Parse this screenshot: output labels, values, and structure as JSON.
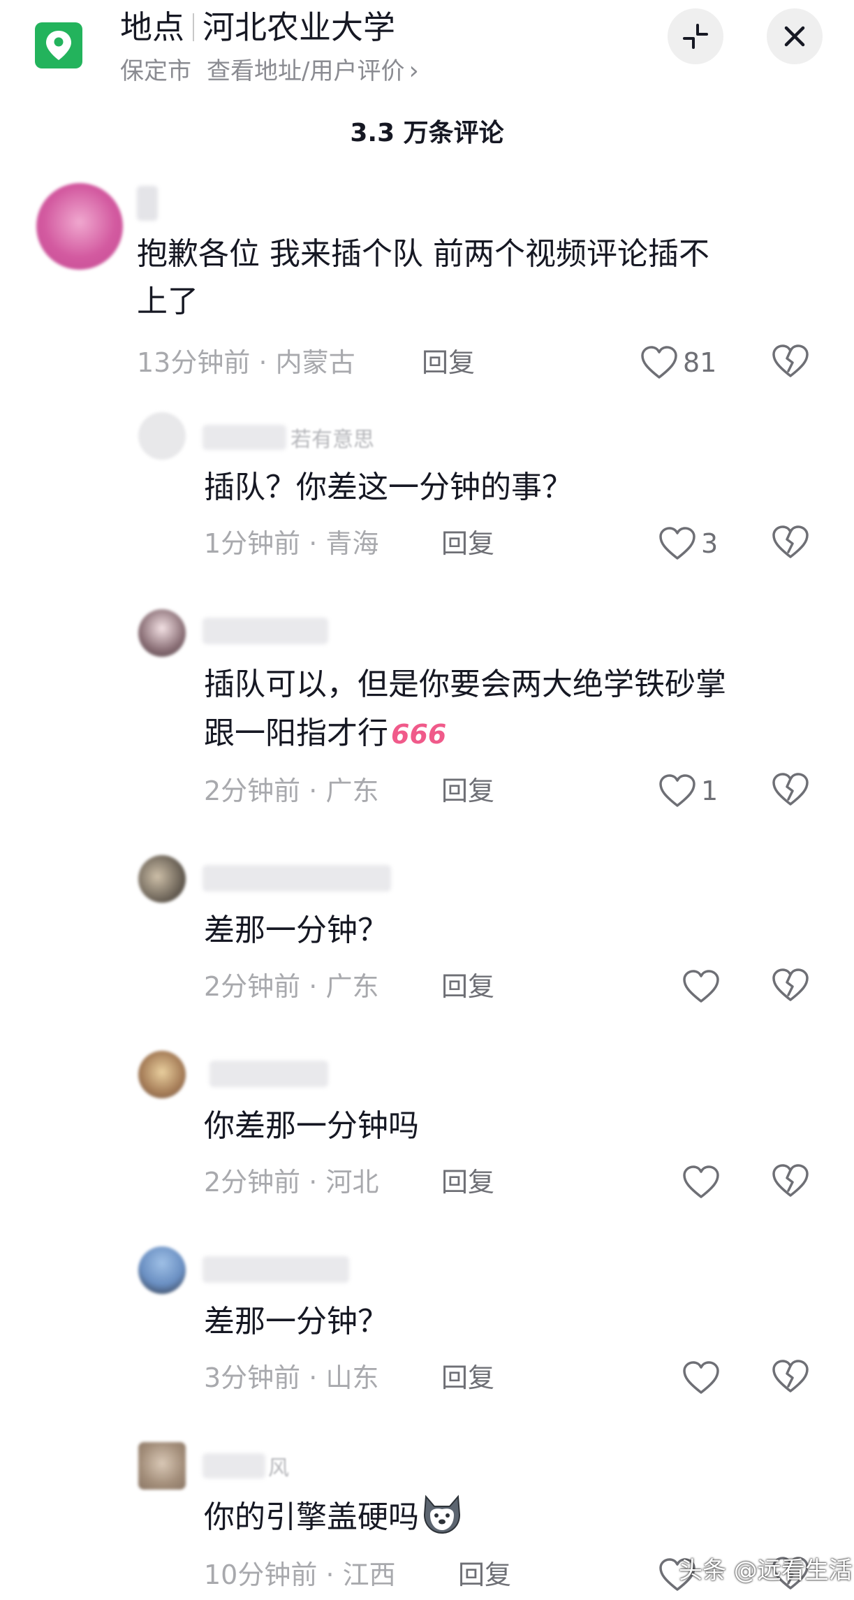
{
  "header": {
    "place_label": "地点",
    "place_name": "河北农业大学",
    "city": "保定市",
    "address_link": "查看地址/用户评价",
    "chevron": "›",
    "collapse_icon": "collapse-icon",
    "close_icon": "close-icon"
  },
  "comments_count_title": "3.3 万条评论",
  "comments": [
    {
      "name_fragment": "",
      "text_lines": [
        "抱歉各位   我来插个队  前两个视频评论插不",
        "上了"
      ],
      "time": "13分钟前",
      "region": "内蒙古",
      "reply": "回复",
      "likes": "81"
    },
    {
      "name_fragment": "若有意思",
      "text_lines": [
        "插队？你差这一分钟的事？"
      ],
      "time": "1分钟前",
      "region": "青海",
      "reply": "回复",
      "likes": "3"
    },
    {
      "name_fragment": "",
      "text_lines": [
        "插队可以，但是你要会两大绝学铁砂掌",
        "跟一阳指才行"
      ],
      "emoji": "666",
      "time": "2分钟前",
      "region": "广东",
      "reply": "回复",
      "likes": "1"
    },
    {
      "name_fragment": "",
      "text_lines": [
        "差那一分钟？"
      ],
      "time": "2分钟前",
      "region": "广东",
      "reply": "回复",
      "likes": ""
    },
    {
      "name_fragment": "",
      "text_lines": [
        "你差那一分钟吗"
      ],
      "time": "2分钟前",
      "region": "河北",
      "reply": "回复",
      "likes": ""
    },
    {
      "name_fragment": "",
      "text_lines": [
        "差那一分钟？"
      ],
      "time": "3分钟前",
      "region": "山东",
      "reply": "回复",
      "likes": ""
    },
    {
      "name_fragment": "风",
      "text_lines": [
        "你的引擎盖硬吗"
      ],
      "time": "10分钟前",
      "region": "江西",
      "reply": "回复",
      "likes": ""
    }
  ],
  "watermark": "头条 @远看生活",
  "colors": {
    "location_green": "#23b35c",
    "text_primary": "#161823",
    "text_secondary": "#a8a9ad",
    "emoji_pink": "#f05a8a"
  }
}
